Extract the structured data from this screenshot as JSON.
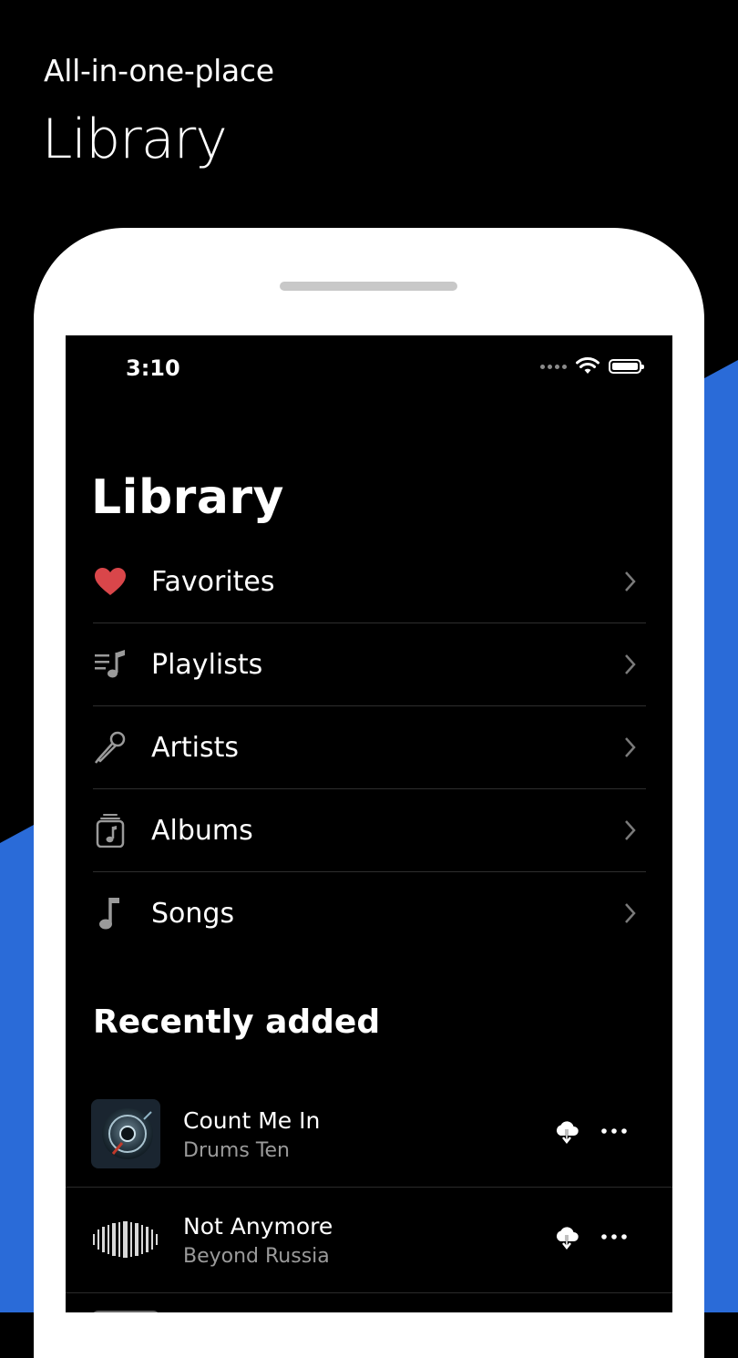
{
  "promo": {
    "subtitle": "All-in-one-place",
    "title": "Library"
  },
  "colors": {
    "accent_blue": "#2a6bd8",
    "heart_red": "#d9464a",
    "background": "#000000"
  },
  "status_bar": {
    "time": "3:10"
  },
  "library": {
    "title": "Library",
    "items": [
      {
        "label": "Favorites",
        "icon": "heart-icon"
      },
      {
        "label": "Playlists",
        "icon": "playlist-icon"
      },
      {
        "label": "Artists",
        "icon": "microphone-icon"
      },
      {
        "label": "Albums",
        "icon": "album-icon"
      },
      {
        "label": "Songs",
        "icon": "music-note-icon"
      }
    ]
  },
  "recently_added": {
    "title": "Recently added",
    "songs": [
      {
        "title": "Count Me In",
        "artist": "Drums Ten"
      },
      {
        "title": "Not Anymore",
        "artist": "Beyond Russia"
      }
    ]
  }
}
